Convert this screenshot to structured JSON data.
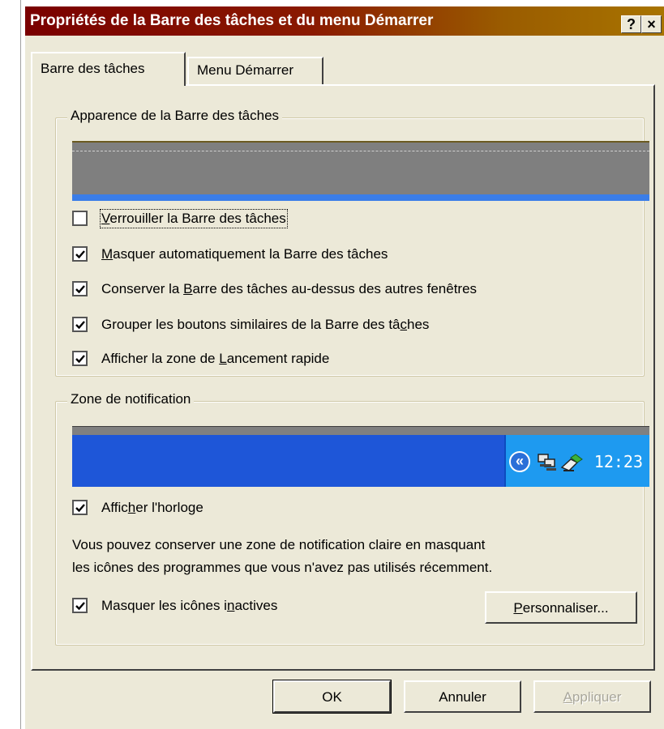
{
  "window": {
    "title": "Propriétés de la Barre des tâches et du menu Démarrer",
    "help_button": "?",
    "close_button": "×"
  },
  "tabs": [
    {
      "label": "Barre des tâches",
      "active": true
    },
    {
      "label": "Menu Démarrer",
      "active": false
    }
  ],
  "appearance_group": {
    "label": "Apparence de la Barre des tâches",
    "checkboxes": [
      {
        "pre": "",
        "mnemonic": "V",
        "post": "errouiller la Barre des tâches",
        "checked": false,
        "focused": true
      },
      {
        "pre": "",
        "mnemonic": "M",
        "post": "asquer automatiquement la Barre des tâches",
        "checked": true,
        "focused": false
      },
      {
        "pre": "Conserver la ",
        "mnemonic": "B",
        "post": "arre des tâches au-dessus des autres fenêtres",
        "checked": true,
        "focused": false
      },
      {
        "pre": "Grouper les boutons similaires de la Barre des tâ",
        "mnemonic": "c",
        "post": "hes",
        "checked": true,
        "focused": false
      },
      {
        "pre": "Afficher la zone de ",
        "mnemonic": "L",
        "post": "ancement rapide",
        "checked": true,
        "focused": false
      }
    ]
  },
  "notification_group": {
    "label": "Zone de notification",
    "clock_time": "12:23",
    "show_clock": {
      "pre": "Affic",
      "mnemonic": "h",
      "post": "er l'horloge",
      "checked": true
    },
    "description_line1": "Vous pouvez conserver une zone de notification claire en masquant",
    "description_line2": "les icônes des programmes que vous n'avez pas utilisés récemment.",
    "hide_inactive": {
      "pre": "Masquer les icônes i",
      "mnemonic": "n",
      "post": "actives",
      "checked": true
    },
    "customize_button": {
      "mnemonic": "P",
      "post": "ersonnaliser..."
    }
  },
  "footer": {
    "ok_label": "OK",
    "cancel_label": "Annuler",
    "apply": {
      "mnemonic": "A",
      "post": "ppliquer",
      "enabled": false
    }
  },
  "colors": {
    "dialog_bg": "#ece9d8",
    "title_gradient_start": "#7a0000",
    "title_gradient_end": "#a87400",
    "taskbar_blue": "#1e56d8",
    "tray_blue": "#1e9af0"
  },
  "icons": [
    "chevron-left-double-icon",
    "network-icon",
    "connection-icon",
    "checkmark-icon"
  ]
}
